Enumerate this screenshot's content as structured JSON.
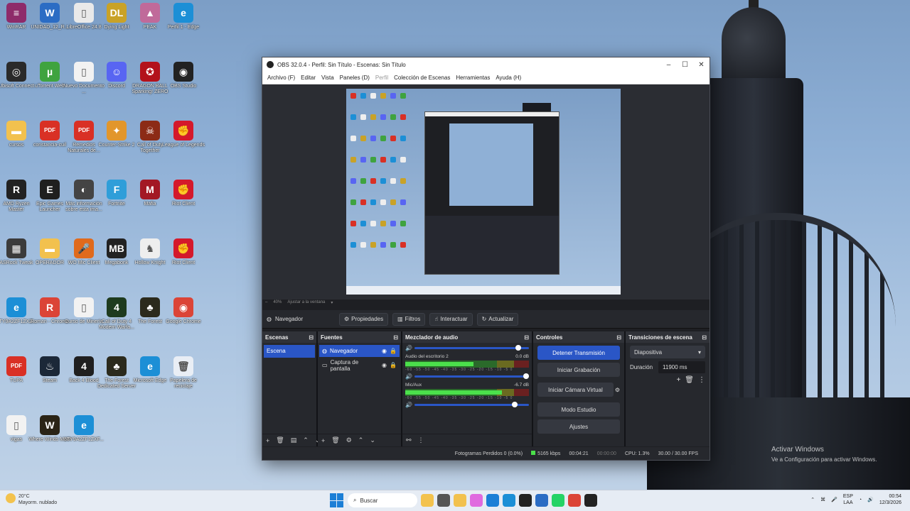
{
  "desktop": {
    "icons": [
      {
        "label": "WinRAR",
        "color": "#8e2b6a",
        "glyph": "≡"
      },
      {
        "label": "UNIDAD_12_R...",
        "color": "#2b6cc4",
        "glyph": "W"
      },
      {
        "label": "LibreOffice 24.8",
        "color": "#e9e9e9",
        "glyph": "▯"
      },
      {
        "label": "Dying Light",
        "color": "#c9a227",
        "glyph": "DL"
      },
      {
        "label": "PEAK",
        "color": "#c06a9a",
        "glyph": "▲"
      },
      {
        "label": "Perfil 1 - Edge",
        "color": "#1c8fd6",
        "glyph": "e"
      },
      {
        "label": "Ubisoft Connect",
        "color": "#2a2a2a",
        "glyph": "◎"
      },
      {
        "label": "uTorrent Web",
        "color": "#3fa33f",
        "glyph": "µ"
      },
      {
        "label": "Nuevo Documento ...",
        "color": "#f2f2f2",
        "glyph": "▯"
      },
      {
        "label": "Discord",
        "color": "#5865f2",
        "glyph": "☺"
      },
      {
        "label": "DRAGON BALL Sparking! ZERO",
        "color": "#b3121b",
        "glyph": "✪"
      },
      {
        "label": "OBS Studio",
        "color": "#222",
        "glyph": "◉"
      },
      {
        "label": "cursos",
        "color": "#f2c14e",
        "glyph": "▬"
      },
      {
        "label": "constancia-cuil",
        "color": "#d93025",
        "glyph": "PDF"
      },
      {
        "label": "Remedios Naturales de...",
        "color": "#d93025",
        "glyph": "PDF"
      },
      {
        "label": "Counter-Strike 2",
        "color": "#e2962b",
        "glyph": "✦"
      },
      {
        "label": "Call of Duty Together",
        "color": "#8c2b16",
        "glyph": "☠"
      },
      {
        "label": "League of Legends",
        "color": "#d4192b",
        "glyph": "✊"
      },
      {
        "label": "AMD Ryzen Master",
        "color": "#222",
        "glyph": "R"
      },
      {
        "label": "Epic Games Launcher",
        "color": "#1f1f1f",
        "glyph": "E"
      },
      {
        "label": "Más información sobre esta ima...",
        "color": "#444",
        "glyph": "◐"
      },
      {
        "label": "Fortnite",
        "color": "#2f9ed9",
        "glyph": "F"
      },
      {
        "label": "Mafia",
        "color": "#a31824",
        "glyph": "M"
      },
      {
        "label": "Riot Client",
        "color": "#d4192b",
        "glyph": "✊"
      },
      {
        "label": "ASRock Tweak",
        "color": "#3b3b3b",
        "glyph": "▦"
      },
      {
        "label": "OPERADOR",
        "color": "#f2c14e",
        "glyph": "▬"
      },
      {
        "label": "WO Mic Client",
        "color": "#e06a1c",
        "glyph": "🎤"
      },
      {
        "label": "Megabonk",
        "color": "#222",
        "glyph": "MB"
      },
      {
        "label": "Hollow Knight",
        "color": "#eee",
        "glyph": "♞"
      },
      {
        "label": "Riot Client",
        "color": "#d4192b",
        "glyph": "✊"
      },
      {
        "label": "3TY9A2ZF1ZXZ...",
        "color": "#1c8fd6",
        "glyph": "e"
      },
      {
        "label": "Roman - Chrome",
        "color": "#db4437",
        "glyph": "R"
      },
      {
        "label": "Curso de Minería",
        "color": "#f2f2f2",
        "glyph": "▯"
      },
      {
        "label": "Call of Duty 4 Modern Warfa...",
        "color": "#1e3b1e",
        "glyph": "4"
      },
      {
        "label": "The Forest",
        "color": "#2b2a1c",
        "glyph": "♣"
      },
      {
        "label": "Google Chrome",
        "color": "#db4437",
        "glyph": "◉"
      },
      {
        "label": "TUPA",
        "color": "#d93025",
        "glyph": "PDF"
      },
      {
        "label": "Steam",
        "color": "#1b2838",
        "glyph": "♨"
      },
      {
        "label": "Back 4 Blood",
        "color": "#1f1f1f",
        "glyph": "4"
      },
      {
        "label": "The Forest Dedicated Server",
        "color": "#2b2a1c",
        "glyph": "♣"
      },
      {
        "label": "Microsoft Edge",
        "color": "#1c8fd6",
        "glyph": "e"
      },
      {
        "label": "Papelera de reciclaje",
        "color": "#e9eef5",
        "glyph": "🗑"
      },
      {
        "label": "vigas",
        "color": "#f2f2f2",
        "glyph": "▯"
      },
      {
        "label": "Where Winds Meet",
        "color": "#2b2416",
        "glyph": "W"
      },
      {
        "label": "3TY9A2ZF1ZXF...",
        "color": "#1c8fd6",
        "glyph": "e"
      }
    ]
  },
  "activate_windows": {
    "title": "Activar Windows",
    "subtitle": "Ve a Configuración para activar Windows."
  },
  "obs": {
    "title": "OBS 32.0.4 - Perfil: Sin Título - Escenas: Sin Título",
    "menu": [
      "Archivo (F)",
      "Editar",
      "Vista",
      "Paneles (D)",
      "Perfil",
      "Colección de Escenas",
      "Herramientas",
      "Ayuda (H)"
    ],
    "zoom": {
      "level": "40%",
      "fit": "Ajustar a la ventana"
    },
    "source_toolbar": {
      "source_name": "Navegador",
      "properties": "Propiedades",
      "filters": "Filtros",
      "interact": "Interactuar",
      "refresh": "Actualizar"
    },
    "scenes": {
      "title": "Escenas",
      "items": [
        "Escena"
      ]
    },
    "sources": {
      "title": "Fuentes",
      "items": [
        "Navegador",
        "Captura de pantalla"
      ]
    },
    "mixer": {
      "title": "Mezclador de audio",
      "channels": [
        {
          "name": "",
          "db": "",
          "level": 0.0,
          "fader": 0.93
        },
        {
          "name": "Audio del escritorio 2",
          "db": "0.0 dB",
          "level": 0.55,
          "fader": 1.0
        },
        {
          "name": "Mic/Aux",
          "db": "-6.7 dB",
          "level": 0.78,
          "fader": 0.9
        }
      ],
      "ticks": "-60 -55 -50 -45 -40 -35 -30 -25 -20 -15 -10 -5 0"
    },
    "controls": {
      "title": "Controles",
      "start_stream": "Detener Transmisión",
      "start_record": "Iniciar Grabación",
      "virtual_cam": "Iniciar Cámara Virtual",
      "studio_mode": "Modo Estudio",
      "settings": "Ajustes"
    },
    "transitions": {
      "title": "Transiciones de escena",
      "selected": "Diapositiva",
      "duration_label": "Duración",
      "duration_value": "11900 ms"
    },
    "status": {
      "dropped": "Fotogramas Perdidos 0 (0.0%)",
      "bitrate": "5165 kbps",
      "stream_time": "00:04:21",
      "rec_time": "00:00:00",
      "cpu": "CPU: 1.3%",
      "fps": "30.00 / 30.00 FPS"
    }
  },
  "taskbar": {
    "weather_temp": "20°C",
    "weather_desc": "Mayorm. nublado",
    "search_placeholder": "Buscar",
    "lang": "ESP",
    "lang2": "LAA",
    "time": "00:54",
    "date": "12/3/2026"
  }
}
